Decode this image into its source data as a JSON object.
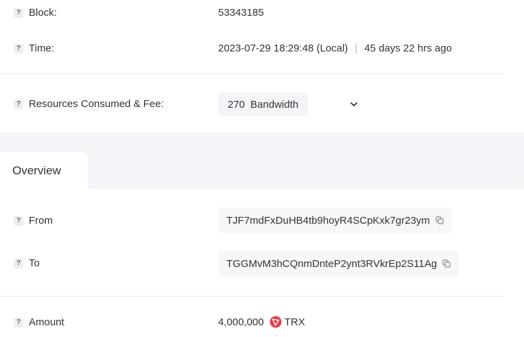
{
  "block": {
    "label": "Block:",
    "value": "53343185"
  },
  "time": {
    "label": "Time:",
    "local": "2023-07-29 18:29:48 (Local)",
    "separator": "|",
    "ago": "45 days 22 hrs ago"
  },
  "resources": {
    "label": "Resources Consumed & Fee:",
    "amount": "270",
    "unit": "Bandwidth"
  },
  "overview": {
    "tab_label": "Overview"
  },
  "from": {
    "label": "From",
    "address": "TJF7mdFxDuHB4tb9hoyR4SCpKxk7gr23ym"
  },
  "to": {
    "label": "To",
    "address": "TGGMvM3hCQnmDnteP2ynt3RVkrEp2S11Ag"
  },
  "amount": {
    "label": "Amount",
    "value": "4,000,000",
    "token": "TRX"
  },
  "icons": {
    "help": "?",
    "copy": "copy-icon",
    "chevron": "chevron-down-icon",
    "token": "trx-icon"
  },
  "colors": {
    "trx": "#e5414e",
    "divider": "#e8eaee"
  }
}
